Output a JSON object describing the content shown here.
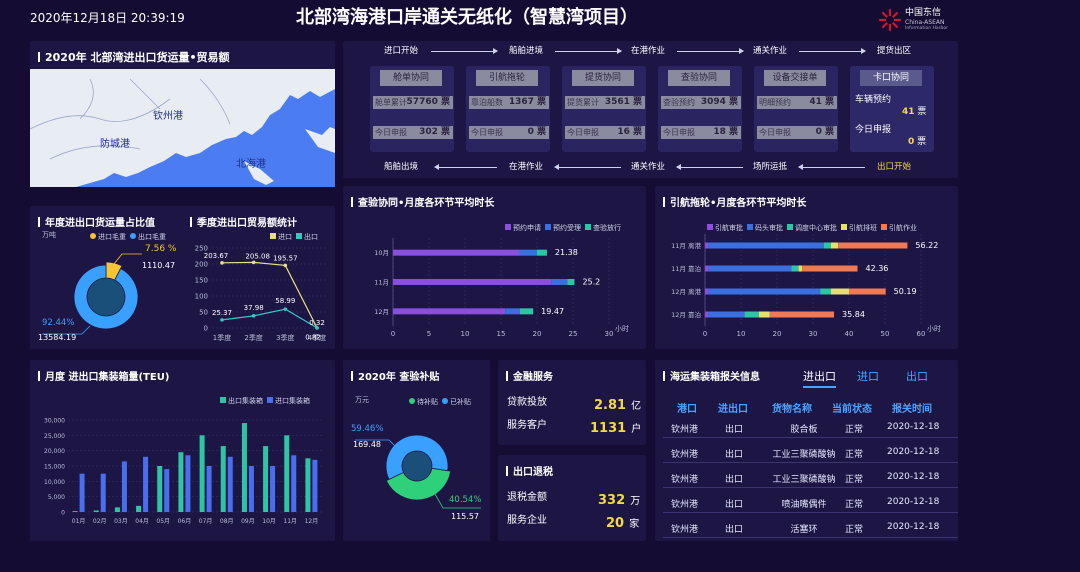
{
  "header": {
    "datetime": "2020年12月18日  20:39:19",
    "title": "北部湾海港口岸通关无纸化（智慧湾项目）",
    "logo_cn": "中国东信",
    "logo_en": "China-ASEAN",
    "logo_sub": "Information Harbor"
  },
  "map": {
    "title": "2020年  北部湾进出口货运量•贸易额",
    "places": [
      "钦州港",
      "防城港",
      "北海港"
    ]
  },
  "flow": {
    "top": [
      "进口开始",
      "船舶进境",
      "在港作业",
      "通关作业",
      "提货出区"
    ],
    "bottom": [
      "船舶出境",
      "在港作业",
      "通关作业",
      "场所运抵",
      "出口开始"
    ],
    "cards": [
      {
        "title": "舱单协同",
        "rows": [
          {
            "label": "舱单累计",
            "value": "57760 票"
          },
          {
            "label": "今日申报",
            "value": "302 票"
          }
        ]
      },
      {
        "title": "引航拖轮",
        "rows": [
          {
            "label": "靠泊船数",
            "value": "1367 票"
          },
          {
            "label": "今日申报",
            "value": "0 票"
          }
        ]
      },
      {
        "title": "提货协同",
        "rows": [
          {
            "label": "提货累计",
            "value": "3561 票"
          },
          {
            "label": "今日申报",
            "value": "16 票"
          }
        ]
      },
      {
        "title": "查验协同",
        "rows": [
          {
            "label": "查验预约",
            "value": "3094 票"
          },
          {
            "label": "今日申报",
            "value": "18 票"
          }
        ]
      },
      {
        "title": "设备交接单",
        "rows": [
          {
            "label": "明细预约",
            "value": "41 票"
          },
          {
            "label": "今日申报",
            "value": "0 票"
          }
        ]
      }
    ],
    "card_last": {
      "title": "卡口协同",
      "row1_label": "车辆预约",
      "row1_value": "41",
      "row1_unit": "票",
      "row2_label": "今日申报",
      "row2_value": "0",
      "row2_unit": "票"
    }
  },
  "ratio": {
    "title": "年度进出口货运量占比值",
    "unit": "万吨",
    "legend": [
      "进口毛重",
      "出口毛重"
    ],
    "pct_import": "7.56 %",
    "val_import": "1110.47",
    "pct_export": "92.44%",
    "val_export": "13584.19"
  },
  "quarter": {
    "title": "季度进出口贸易额统计",
    "legend": [
      "进口",
      "出口"
    ]
  },
  "inspect": {
    "title": "查验协同•月度各环节平均时长",
    "legend": [
      "预约申请",
      "预约受理",
      "查验放行"
    ],
    "unit": "小时"
  },
  "pilot": {
    "title": "引航拖轮•月度各环节平均时长",
    "legend": [
      "引航审批",
      "码头审批",
      "调度中心审批",
      "引航排班",
      "引航作业"
    ],
    "unit": "小时"
  },
  "teu": {
    "title": "月度 进出口集装箱量(TEU)",
    "legend": [
      "出口集装箱",
      "进口集装箱"
    ]
  },
  "subsidy": {
    "title": "2020年 查验补贴",
    "unit": "万元",
    "legend": [
      "待补贴",
      "已补贴"
    ],
    "pct_paid": "59.46%",
    "val_paid": "169.48",
    "pct_pending": "40.54%",
    "val_pending": "115.57"
  },
  "finance": {
    "title": "金融服务",
    "rows": [
      {
        "label": "贷款投放",
        "value": "2.81",
        "unit": "亿"
      },
      {
        "label": "服务客户",
        "value": "1131",
        "unit": "户"
      }
    ]
  },
  "tax": {
    "title": "出口退税",
    "rows": [
      {
        "label": "退税金额",
        "value": "332",
        "unit": "万"
      },
      {
        "label": "服务企业",
        "value": "20",
        "unit": "家"
      }
    ]
  },
  "customs": {
    "title": "海运集装箱报关信息",
    "tabs": [
      "进出口",
      "进口",
      "出口"
    ],
    "headers": [
      "港口",
      "进出口",
      "货物名称",
      "当前状态",
      "报关时间"
    ],
    "rows": [
      [
        "钦州港",
        "出口",
        "胶合板",
        "正常",
        "2020-12-18"
      ],
      [
        "钦州港",
        "出口",
        "工业三聚磷酸钠",
        "正常",
        "2020-12-18"
      ],
      [
        "钦州港",
        "出口",
        "工业三聚磷酸钠",
        "正常",
        "2020-12-18"
      ],
      [
        "钦州港",
        "出口",
        "喷油嘴偶件",
        "正常",
        "2020-12-18"
      ],
      [
        "钦州港",
        "出口",
        "活塞环",
        "正常",
        "2020-12-18"
      ]
    ]
  },
  "chart_data": [
    {
      "type": "pie",
      "title": "年度进出口货运量占比值",
      "unit": "万吨",
      "categories": [
        "进口毛重",
        "出口毛重"
      ],
      "values": [
        1110.47,
        13584.19
      ],
      "percents": [
        7.56,
        92.44
      ],
      "colors": [
        "#f5c338",
        "#3aa0ff"
      ]
    },
    {
      "type": "line",
      "title": "季度进出口贸易额统计",
      "categories": [
        "1季度",
        "2季度",
        "3季度",
        "4季度"
      ],
      "series": [
        {
          "name": "进口",
          "values": [
            203.67,
            205.08,
            195.57,
            0.82
          ],
          "color": "#e8e07a"
        },
        {
          "name": "出口",
          "values": [
            25.37,
            37.98,
            58.99,
            0.32
          ],
          "color": "#36c8c0"
        }
      ],
      "ylim": [
        0,
        250
      ],
      "yticks": [
        0,
        50,
        100,
        150,
        200,
        250
      ]
    },
    {
      "type": "bar",
      "title": "查验协同•月度各环节平均时长",
      "orientation": "horizontal",
      "stacked": true,
      "categories": [
        "10月",
        "11月",
        "12月"
      ],
      "series": [
        {
          "name": "预约申请",
          "values": [
            17.5,
            22.0,
            15.6
          ],
          "color": "#8b4fe0"
        },
        {
          "name": "预约受理",
          "values": [
            2.5,
            2.2,
            2.0
          ],
          "color": "#3b6fe0"
        },
        {
          "name": "查验放行",
          "values": [
            1.38,
            1.0,
            1.87
          ],
          "color": "#2ec5a4"
        }
      ],
      "totals": [
        21.38,
        25.2,
        19.47
      ],
      "xlim": [
        0,
        30
      ],
      "xlabel": "小时"
    },
    {
      "type": "bar",
      "title": "引航拖轮•月度各环节平均时长",
      "orientation": "horizontal",
      "stacked": true,
      "categories": [
        "11月 离港",
        "11月 靠泊",
        "12月 离港",
        "12月 靠泊"
      ],
      "series": [
        {
          "name": "引航审批",
          "values": [
            1,
            1,
            1,
            1
          ],
          "color": "#8b4fe0"
        },
        {
          "name": "码头审批",
          "values": [
            32,
            23,
            31,
            10
          ],
          "color": "#3b6fe0"
        },
        {
          "name": "调度中心审批",
          "values": [
            2,
            2,
            3,
            4
          ],
          "color": "#2ec5a4"
        },
        {
          "name": "引航排班",
          "values": [
            2,
            1,
            5,
            3
          ],
          "color": "#e6e06a"
        },
        {
          "name": "引航作业",
          "values": [
            19.22,
            15.36,
            10.19,
            17.84
          ],
          "color": "#f07a55"
        }
      ],
      "totals": [
        56.22,
        42.36,
        50.19,
        35.84
      ],
      "xlim": [
        0,
        60
      ],
      "xlabel": "小时"
    },
    {
      "type": "bar",
      "title": "月度 进出口集装箱量(TEU)",
      "categories": [
        "01月",
        "02月",
        "03月",
        "04月",
        "05月",
        "06月",
        "07月",
        "08月",
        "09月",
        "10月",
        "11月",
        "12月"
      ],
      "series": [
        {
          "name": "出口集装箱",
          "values": [
            300,
            500,
            1500,
            2000,
            15000,
            19500,
            25000,
            21500,
            29000,
            21500,
            25000,
            17500
          ],
          "color": "#2ec5a4"
        },
        {
          "name": "进口集装箱",
          "values": [
            12500,
            12500,
            16500,
            18000,
            14000,
            18500,
            15000,
            18000,
            15000,
            15000,
            18500,
            17000
          ],
          "color": "#4a6ef0"
        }
      ],
      "ylim": [
        0,
        30000
      ],
      "yticks": [
        0,
        5000,
        10000,
        15000,
        20000,
        25000,
        30000
      ]
    },
    {
      "type": "pie",
      "title": "2020年 查验补贴",
      "unit": "万元",
      "categories": [
        "待补贴",
        "已补贴"
      ],
      "values": [
        115.57,
        169.48
      ],
      "percents": [
        40.54,
        59.46
      ],
      "colors": [
        "#2ed07a",
        "#3aa0ff"
      ]
    }
  ]
}
